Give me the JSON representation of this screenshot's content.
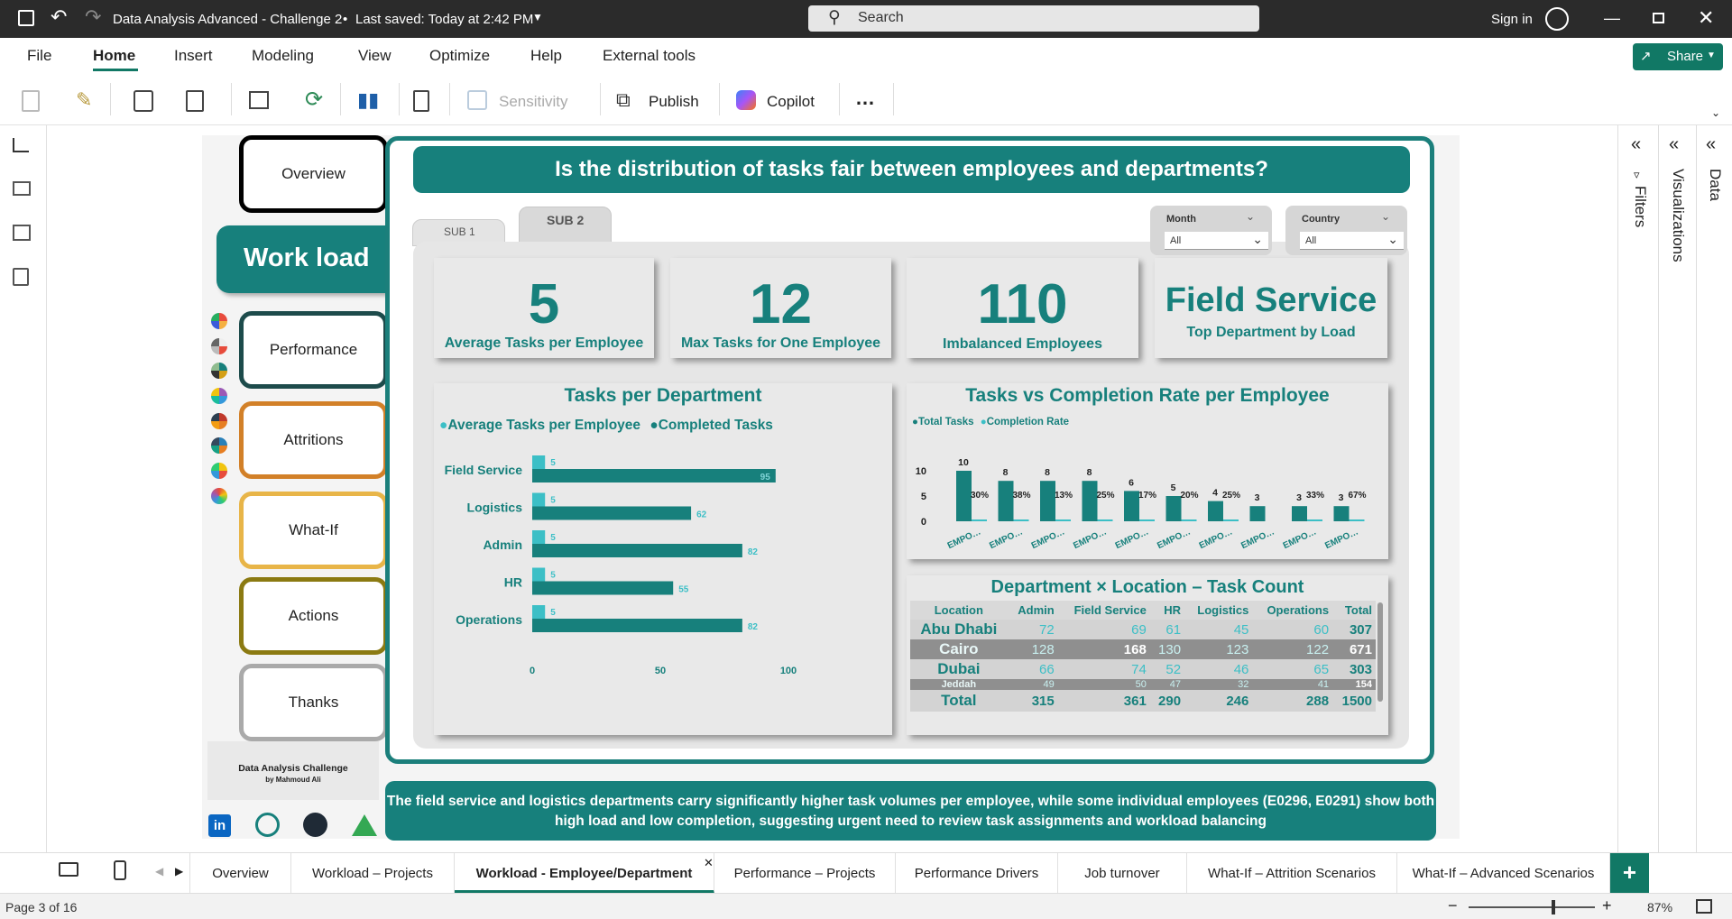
{
  "app": {
    "title": "Data Analysis Advanced - Challenge 2",
    "saved": "Last saved: Today at 2:42 PM",
    "search_placeholder": "Search",
    "signin": "Sign in",
    "share": "Share"
  },
  "menu": [
    "File",
    "Home",
    "Insert",
    "Modeling",
    "View",
    "Optimize",
    "Help",
    "External tools"
  ],
  "ribbon": {
    "sensitivity": "Sensitivity",
    "publish": "Publish",
    "copilot": "Copilot",
    "more": "…"
  },
  "panes": {
    "filters": "Filters",
    "visualizations": "Visualizations",
    "data": "Data"
  },
  "nav": {
    "overview": "Overview",
    "workload": "Work load",
    "performance": "Performance",
    "attritions": "Attritions",
    "whatif": "What-If",
    "actions": "Actions",
    "thanks": "Thanks",
    "credit_title": "Data Analysis Challenge",
    "credit_by": "by Mahmoud Ali"
  },
  "colors": {
    "teal": "#17807c",
    "teal_light": "#3cbfc6",
    "teal_dark": "#116d69"
  },
  "question": "Is the distribution of tasks fair between employees and departments?",
  "subtabs": [
    "SUB 1",
    "SUB 2"
  ],
  "slicers": [
    {
      "label": "Month",
      "value": "All"
    },
    {
      "label": "Country",
      "value": "All"
    }
  ],
  "kpis": [
    {
      "value": "5",
      "label": "Average Tasks per Employee"
    },
    {
      "value": "12",
      "label": "Max Tasks for One Employee"
    },
    {
      "value": "110",
      "label": "Imbalanced Employees"
    },
    {
      "value": "Field Service",
      "label": "Top Department by Load"
    }
  ],
  "chart_data": [
    {
      "type": "bar",
      "orientation": "horizontal",
      "title": "Tasks per Department",
      "categories": [
        "Field Service",
        "Logistics",
        "Admin",
        "HR",
        "Operations"
      ],
      "series": [
        {
          "name": "Average Tasks per Employee",
          "color": "#3cbfc6",
          "values": [
            5,
            5,
            5,
            5,
            5
          ]
        },
        {
          "name": "Completed Tasks",
          "color": "#17807c",
          "values": [
            95,
            62,
            82,
            55,
            82
          ]
        }
      ],
      "xticks": [
        "0",
        "50",
        "100"
      ],
      "xlim": [
        0,
        100
      ],
      "legend": "top-left"
    },
    {
      "type": "bar",
      "title": "Tasks vs Completion Rate per Employee",
      "categories": [
        "EMPO…",
        "EMPO…",
        "EMPO…",
        "EMPO…",
        "EMPO…",
        "EMPO…",
        "EMPO…",
        "EMPO…",
        "EMPO…",
        "EMPO…"
      ],
      "series": [
        {
          "name": "Total Tasks",
          "color": "#17807c",
          "values": [
            10,
            8,
            8,
            8,
            6,
            5,
            4,
            3,
            3,
            3
          ]
        },
        {
          "name": "Completion Rate",
          "color": "#3cbfc6",
          "values": [
            30,
            38,
            13,
            25,
            17,
            20,
            25,
            null,
            33,
            67
          ],
          "labels": [
            "30%",
            "38%",
            "13%",
            "25%",
            "17%",
            "20%",
            "25%",
            "",
            "33%",
            "67%"
          ]
        }
      ],
      "yticks": [
        "0",
        "5",
        "10"
      ],
      "ylim": [
        0,
        10
      ],
      "legend": "top-left"
    }
  ],
  "matrix": {
    "title": "Department × Location – Task Count",
    "columns": [
      "Location",
      "Admin",
      "Field Service",
      "HR",
      "Logistics",
      "Operations",
      "Total"
    ],
    "rows": [
      [
        "Abu Dhabi",
        "72",
        "69",
        "61",
        "45",
        "60",
        "307"
      ],
      [
        "Cairo",
        "128",
        "168",
        "130",
        "123",
        "122",
        "671"
      ],
      [
        "Dubai",
        "66",
        "74",
        "52",
        "46",
        "65",
        "303"
      ],
      [
        "Jeddah",
        "49",
        "50",
        "47",
        "32",
        "41",
        "154"
      ]
    ],
    "total": [
      "Total",
      "315",
      "361",
      "290",
      "246",
      "288",
      "1500"
    ]
  },
  "caption": "The field service and logistics departments carry significantly higher task volumes per employee, while some individual employees (E0296, E0291) show both high load and low completion, suggesting urgent need to review task assignments and workload balancing",
  "page_tabs": [
    "Overview",
    "Workload – Projects",
    "Workload - Employee/Department",
    "Performance – Projects",
    "Performance Drivers",
    "Job turnover",
    "What-If – Attrition Scenarios",
    "What-If – Advanced Scenarios"
  ],
  "status": {
    "page": "Page 3 of 16",
    "zoom": "87%",
    "zoom_minus": "−",
    "zoom_plus": "+"
  }
}
